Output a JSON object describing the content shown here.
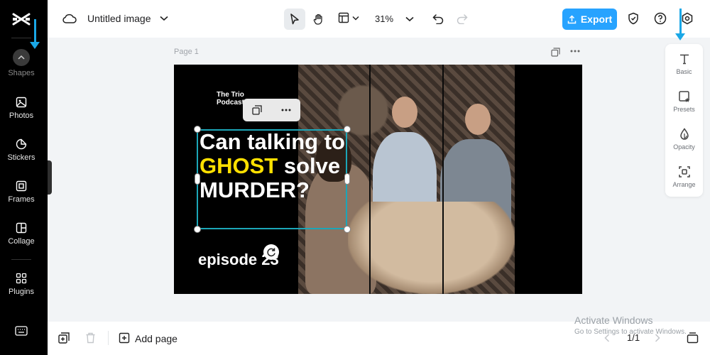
{
  "sidebar": {
    "items": [
      {
        "label": "Shapes"
      },
      {
        "label": "Photos"
      },
      {
        "label": "Stickers"
      },
      {
        "label": "Frames"
      },
      {
        "label": "Collage"
      },
      {
        "label": "Plugins"
      }
    ]
  },
  "topbar": {
    "doc_title": "Untitled image",
    "zoom": "31%",
    "export_label": "Export"
  },
  "canvas": {
    "page_label": "Page 1",
    "design": {
      "brand": "The Trio Podcast",
      "headline_part1": "Can talking to ",
      "headline_highlight": "GHOST",
      "headline_part2": " solve MURDER?",
      "episode": "episode 23"
    }
  },
  "right_panel": {
    "items": [
      {
        "label": "Basic"
      },
      {
        "label": "Presets"
      },
      {
        "label": "Opacity"
      },
      {
        "label": "Arrange"
      }
    ]
  },
  "bottombar": {
    "add_page_label": "Add page",
    "pager": "1/1"
  },
  "watermark": {
    "line1": "Activate Windows",
    "line2": "Go to Settings to activate Windows."
  },
  "colors": {
    "accent": "#27a3ff",
    "selection": "#1ca6b8",
    "highlight": "#ffe000",
    "annotation_arrow": "#1aa7e6"
  }
}
